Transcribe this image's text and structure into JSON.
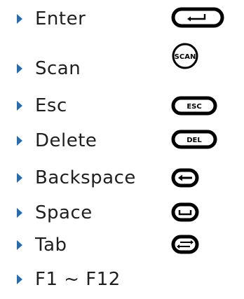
{
  "items": [
    {
      "label": "Enter",
      "icon": "enter-key-icon"
    },
    {
      "label": "Scan",
      "icon": "scan-key-icon",
      "key_text": "SCAN"
    },
    {
      "label": "Esc",
      "icon": "esc-key-icon",
      "key_text": "ESC"
    },
    {
      "label": "Delete",
      "icon": "del-key-icon",
      "key_text": "DEL"
    },
    {
      "label": "Backspace",
      "icon": "backspace-key-icon"
    },
    {
      "label": "Space",
      "icon": "space-key-icon"
    },
    {
      "label": "Tab",
      "icon": "tab-key-icon"
    },
    {
      "label": "F1 ~ F12"
    }
  ],
  "colors": {
    "bullet": "#2c6aa8",
    "key_outline": "#000000",
    "text": "#1f1f1f"
  }
}
